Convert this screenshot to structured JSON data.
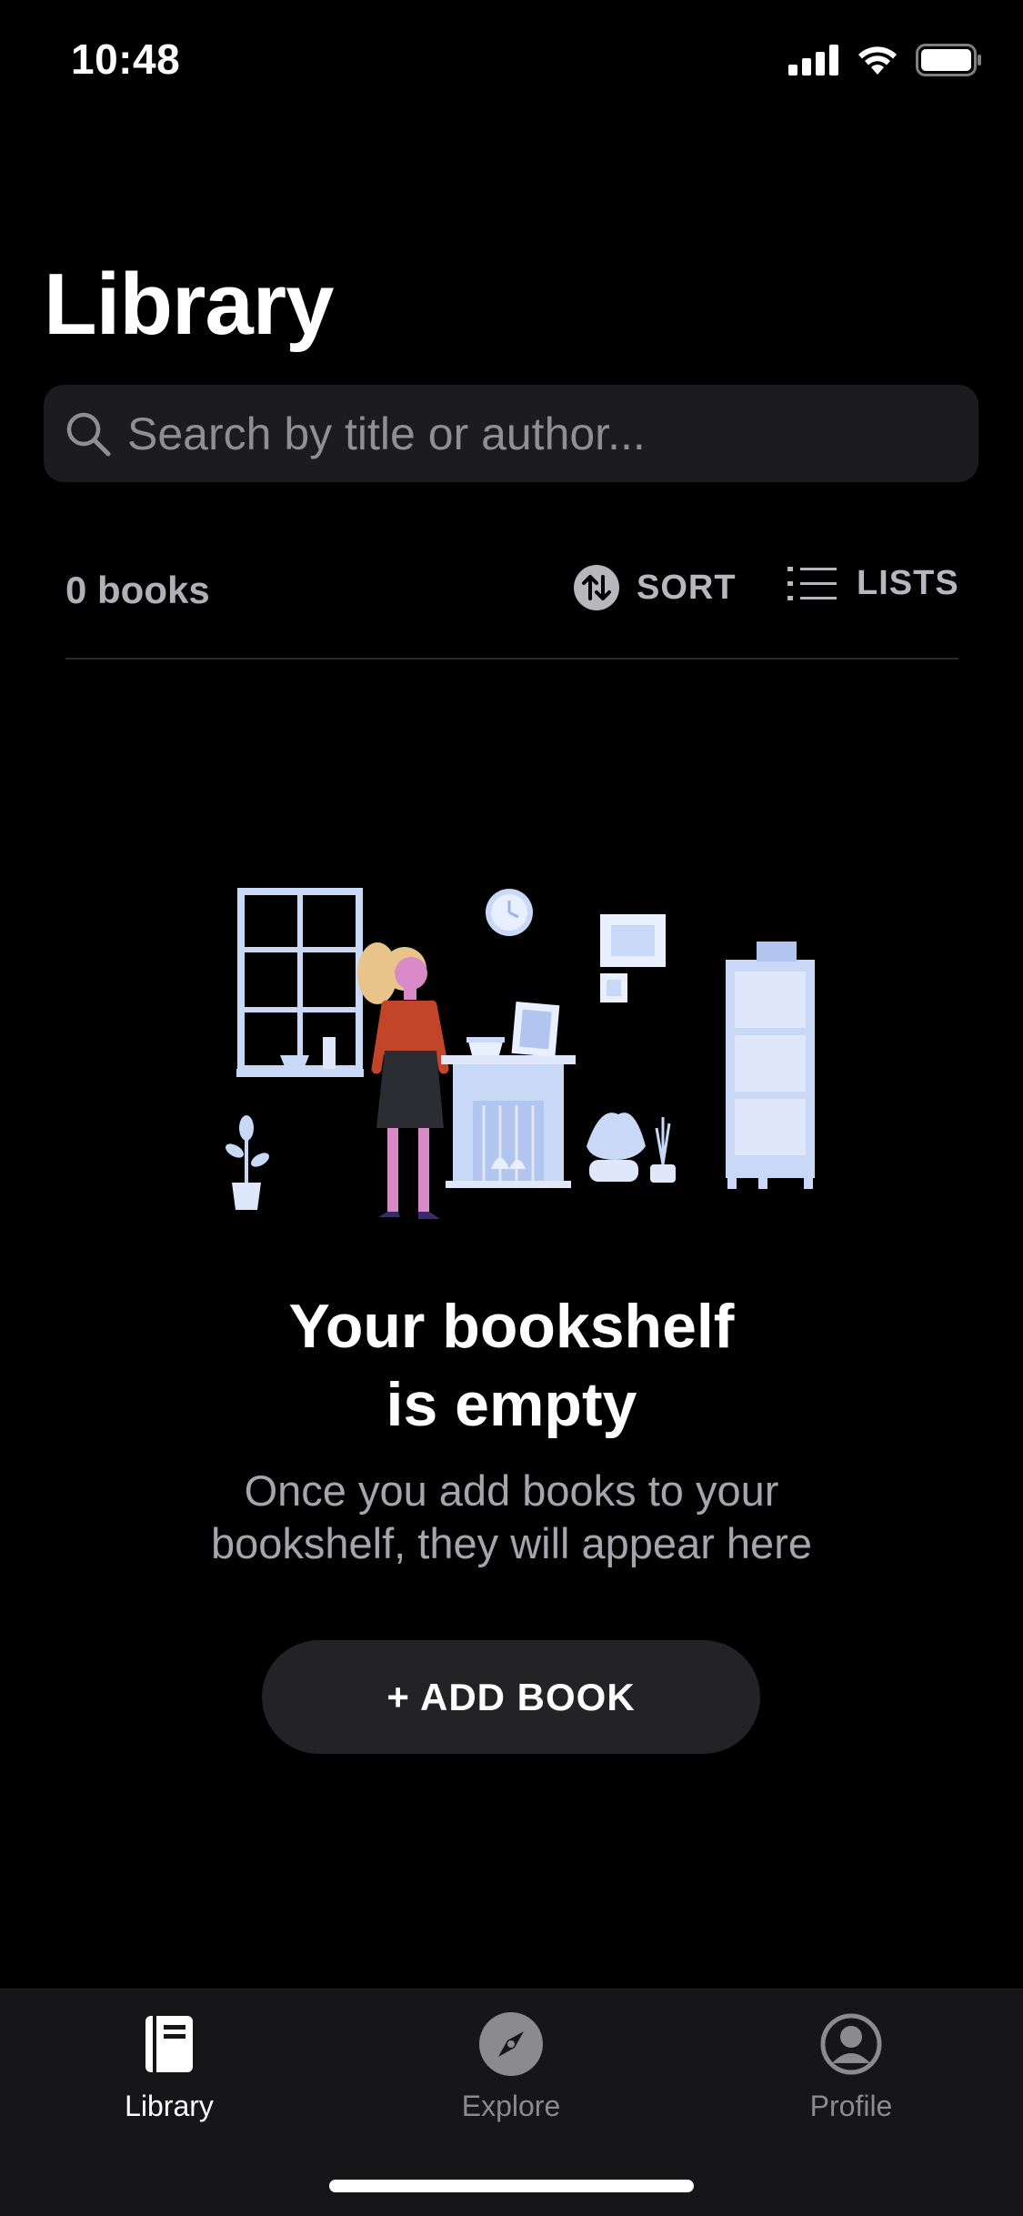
{
  "status_bar": {
    "time": "10:48"
  },
  "header": {
    "title": "Library"
  },
  "search": {
    "placeholder": "Search by title or author..."
  },
  "toolbar": {
    "book_count": "0 books",
    "sort_label": "SORT",
    "lists_label": "LISTS"
  },
  "empty_state": {
    "title_line1": "Your bookshelf",
    "title_line2": "is empty",
    "subtitle_line1": "Once you add books to your",
    "subtitle_line2": "bookshelf, they will appear here",
    "add_button_label": "+ ADD BOOK"
  },
  "tab_bar": {
    "tabs": [
      {
        "label": "Library",
        "icon": "book-icon",
        "active": true
      },
      {
        "label": "Explore",
        "icon": "compass-icon",
        "active": false
      },
      {
        "label": "Profile",
        "icon": "profile-icon",
        "active": false
      }
    ]
  },
  "colors": {
    "background": "#000000",
    "surface": "#1c1c1e",
    "button": "#232325",
    "tab_bar": "#161618",
    "muted_text": "#a5a5aa",
    "illustration_blue": "#c9d8f7",
    "accent_red": "#c2452a",
    "accent_pink": "#d989c6"
  }
}
